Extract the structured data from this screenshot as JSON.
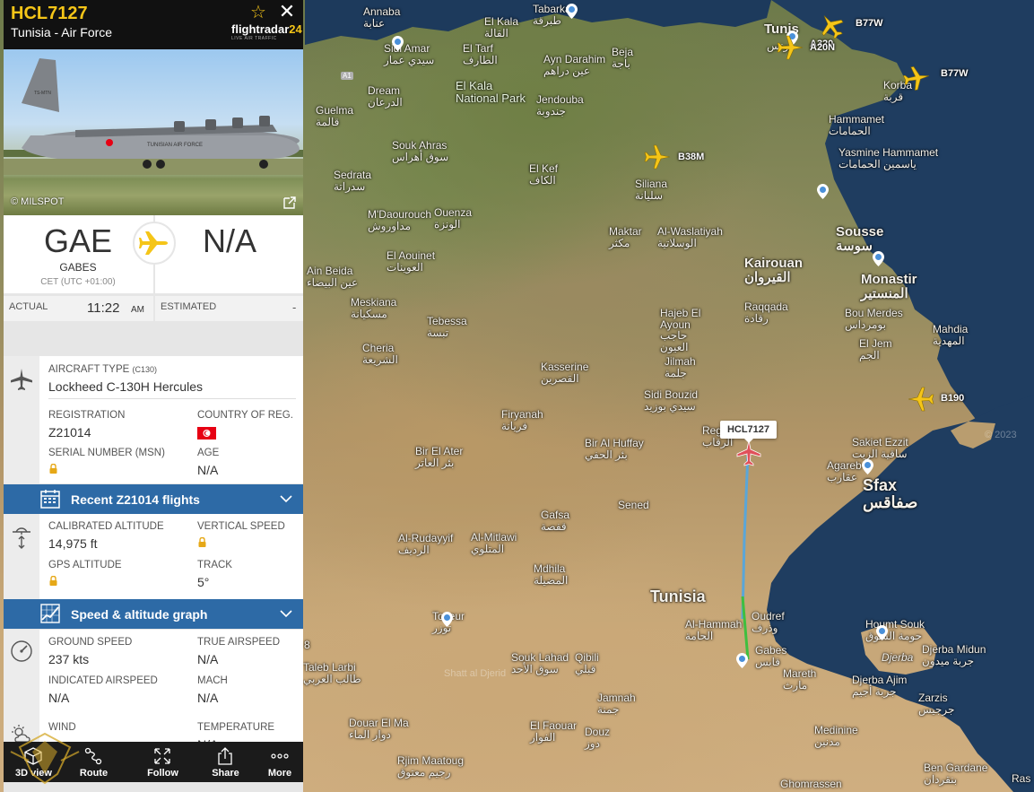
{
  "flight": {
    "callsign": "HCL7127",
    "airline": "Tunisia - Air Force",
    "brand_name": "flightradar",
    "brand_suffix": "24",
    "brand_tagline": "LIVE AIR TRAFFIC",
    "photo_credit": "© MILSPOT",
    "photo_tail_text": "TS-MTN",
    "photo_fuselage_text": "TUNISIAN AIR FORCE"
  },
  "route": {
    "origin_code": "GAE",
    "origin_city": "GABES",
    "origin_tz": "CET (UTC +01:00)",
    "dest_code": "N/A",
    "actual_label": "ACTUAL",
    "actual_time": "11:22",
    "actual_ampm": "AM",
    "estimated_label": "ESTIMATED",
    "estimated_time": "-"
  },
  "aircraft": {
    "type_label": "AIRCRAFT TYPE",
    "type_code": "(C130)",
    "type_value": "Lockheed C-130H Hercules",
    "registration_label": "REGISTRATION",
    "registration_value": "Z21014",
    "country_label": "COUNTRY OF REG.",
    "msn_label": "SERIAL NUMBER (MSN)",
    "age_label": "AGE",
    "age_value": "N/A"
  },
  "recent_flights_bar": "Recent Z21014 flights",
  "altitude": {
    "calibrated_label": "CALIBRATED ALTITUDE",
    "calibrated_value": "14,975 ft",
    "vertical_speed_label": "VERTICAL SPEED",
    "gps_label": "GPS ALTITUDE",
    "track_label": "TRACK",
    "track_value": "5°"
  },
  "graph_bar": "Speed & altitude graph",
  "speed": {
    "ground_label": "GROUND SPEED",
    "ground_value": "237 kts",
    "true_label": "TRUE AIRSPEED",
    "true_value": "N/A",
    "indicated_label": "INDICATED AIRSPEED",
    "indicated_value": "N/A",
    "mach_label": "MACH",
    "mach_value": "N/A"
  },
  "weather": {
    "wind_label": "WIND",
    "temperature_label": "TEMPERATURE",
    "temperature_value": "N/A"
  },
  "toolbar": {
    "view3d": "3D view",
    "route": "Route",
    "follow": "Follow",
    "share": "Share",
    "more": "More"
  },
  "map": {
    "callout": "HCL7127",
    "road_tag": "A1",
    "side_marker": "8",
    "copyright": "© 2023",
    "traffic": [
      {
        "label": "B77W"
      },
      {
        "label": "A320"
      },
      {
        "label": "A20N"
      },
      {
        "label": "B77W"
      },
      {
        "label": "B38M"
      },
      {
        "label": "B190"
      }
    ],
    "places": {
      "annaba": "Annaba",
      "annaba_ar": "عنابة",
      "tabarka": "Tabarka",
      "tabarka_ar": "طبرقة",
      "el_kala": "El Kala",
      "el_kala_ar": "القالة",
      "el_tarf": "El Tarf",
      "el_tarf_ar": "الطارف",
      "sidi_amar": "Sidi Amar",
      "sidi_amar_ar": "سيدي عمار",
      "ayn_darahim": "Ayn Darahim",
      "ayn_darahim_ar": "عين دراهم",
      "beja": "Beja",
      "beja_ar": "باجة",
      "el_kala_park": "El Kala National Park",
      "dream": "Dream",
      "dream_ar": "الدرعان",
      "jendouba": "Jendouba",
      "jendouba_ar": "جندوبة",
      "tunis": "Tunis",
      "tunis_ar": "تونس",
      "korba": "Korba",
      "korba_ar": "قربة",
      "guelma": "Guelma",
      "guelma_ar": "قالمة",
      "souk_ahras": "Souk Ahras",
      "souk_ahras_ar": "سوق أهراس",
      "el_kef": "El Kef",
      "el_kef_ar": "الكاف",
      "siliana": "Siliana",
      "siliana_ar": "سليانة",
      "hammamet": "Hammamet",
      "hammamet_ar": "الحمامات",
      "yasmine_hammamet": "Yasmine Hammamet",
      "yasmine_ar": "ياسمين الحمامات",
      "sedrata": "Sedrata",
      "sedrata_ar": "سدراتة",
      "mdaourouch": "M'Daourouch",
      "mdaourouch_ar": "مداوروش",
      "ouenza": "Ouenza",
      "ouenza_ar": "الونزة",
      "maktar": "Maktar",
      "maktar_ar": "مكثر",
      "el_waslatiyah": "Al-Waslatiyah",
      "el_waslatiyah_ar": "الوسلاتية",
      "sousse": "Sousse",
      "sousse_ar": "سوسة",
      "el_aouinet": "El Aouinet",
      "el_aouinet_ar": "العوينات",
      "kairouan": "Kairouan",
      "kairouan_ar": "القيروان",
      "monastir": "Monastir",
      "monastir_ar": "المنستير",
      "ain_beida": "Ain Beida",
      "ain_beida_ar": "عين البيضاء",
      "meskiana": "Meskiana",
      "meskiana_ar": "مسكيانة",
      "raqqada": "Raqqada",
      "raqqada_ar": "رقادة",
      "bou_merdes": "Bou Merdes",
      "bou_merdes_ar": "بومرداس",
      "hajeb": "Hajeb El Ayoun",
      "hajeb_ar": "حاجب العيون",
      "tebessa": "Tebessa",
      "tebessa_ar": "تبسة",
      "mahdia": "Mahdia",
      "mahdia_ar": "المهدية",
      "el_jem": "El Jem",
      "el_jem_ar": "الجم",
      "cheria": "Cheria",
      "cheria_ar": "الشريعة",
      "jilmah": "Jilmah",
      "jilmah_ar": "جلمة",
      "kasserine": "Kasserine",
      "kasserine_ar": "القصرين",
      "sidi_bouzid": "Sidi Bouzid",
      "sidi_bouzid_ar": "سيدي بوزيد",
      "firyanah": "Firyanah",
      "firyanah_ar": "فريانة",
      "regueb": "Regueb",
      "regueb_ar": "الرقاب",
      "sakiet": "Sakiet Ezzit",
      "sakiet_ar": "ساقية الزيت",
      "bir_el_ater": "Bir El Ater",
      "bir_el_ater_ar": "بئر العاتر",
      "bir_al_huffay": "Bir Al Huffay",
      "bir_al_huffay_ar": "بئر الحفي",
      "agareb": "Agareb",
      "agareb_ar": "عقارب",
      "sfax": "Sfax",
      "sfax_ar": "صفاقس",
      "sened": "Sened",
      "gafsa": "Gafsa",
      "gafsa_ar": "قفصة",
      "al_rudayyif": "Al-Rudayyif",
      "al_rudayyif_ar": "الرديف",
      "al_mitlawi": "Al-Mitlawi",
      "al_mitlawi_ar": "المتلوي",
      "mdhila": "Mdhila",
      "mdhila_ar": "المضيلة",
      "tunisia": "Tunisia",
      "al_hammah": "Al-Hammah",
      "al_hammah_ar": "الحامة",
      "oudref": "Oudref",
      "oudref_ar": "وذرف",
      "gabes": "Gabes",
      "gabes_ar": "قابس",
      "houmt_souk": "Houmt Souk",
      "houmt_souk_ar": "حومة السوق",
      "djerba_midun": "Djerba Midun",
      "djerba_midun_ar": "جربة ميدون",
      "djerba": "Djerba",
      "djerba_ajim": "Djerba Ajim",
      "djerba_ajim_ar": "جربة أجيم",
      "tozeur": "Tozeur",
      "tozeur_ar": "توزر",
      "taleb_larbi": "Taleb Larbi",
      "taleb_larbi_ar": "طالب العربي",
      "souk_lahad": "Souk Lahad",
      "souk_lahad_ar": "سوق الأحد",
      "qibili": "Qibili",
      "qibili_ar": "قبلي",
      "mareth": "Mareth",
      "mareth_ar": "مارث",
      "shatt": "Shatt al Djerid",
      "jamnah": "Jamnah",
      "jamnah_ar": "جمنة",
      "zarzis": "Zarzis",
      "zarzis_ar": "جرجيس",
      "douar_el_ma": "Douar El Ma",
      "douar_el_ma_ar": "دوار الماء",
      "el_faouar": "El Faouar",
      "el_faouar_ar": "الفوار",
      "douz": "Douz",
      "douz_ar": "دوز",
      "medinine": "Medinine",
      "medinine_ar": "مدنين",
      "rjim_maatoug": "Rjim Maatoug",
      "rjim_maatoug_ar": "رجيم معتوق",
      "ben_gardane": "Ben Gardane",
      "ben_gardane_ar": "بنقردان",
      "ghomrassen": "Ghomrassen",
      "ras": "Ras"
    }
  },
  "colors": {
    "accent_yellow": "#f5c518",
    "bar_blue": "#2d6aa6",
    "track_blue": "#5aa6d8",
    "track_green": "#3fbf3f",
    "sea": "#1d3a5c",
    "flag_red": "#e70013"
  }
}
